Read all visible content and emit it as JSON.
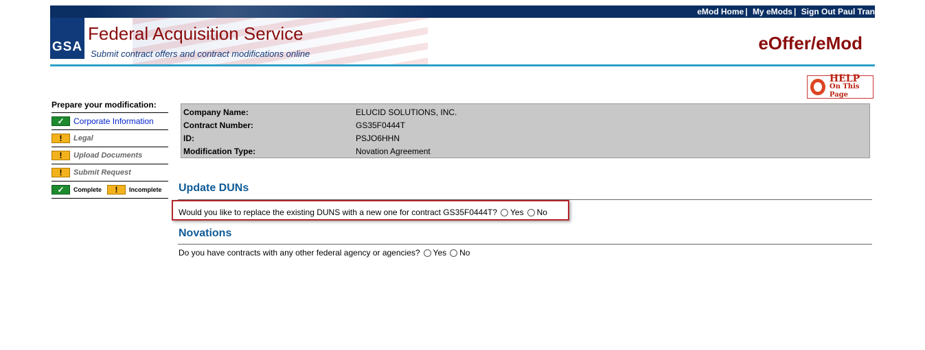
{
  "topnav": {
    "links": [
      "eMod Home",
      "My eMods",
      "Sign Out Paul Tran"
    ],
    "separator": "|"
  },
  "header": {
    "logo_text": "GSA",
    "title": "Federal Acquisition Service",
    "subtitle": "Submit contract offers and contract modifications online",
    "app_title": "eOffer/eMod"
  },
  "help": {
    "line1": "HELP",
    "line2": "On This Page"
  },
  "sidebar": {
    "heading": "Prepare your modification:",
    "items": [
      {
        "label": "Corporate Information",
        "status": "complete",
        "status_glyph": "✓"
      },
      {
        "label": "Legal",
        "status": "incomplete",
        "status_glyph": "!"
      },
      {
        "label": "Upload Documents",
        "status": "incomplete",
        "status_glyph": "!"
      },
      {
        "label": "Submit Request",
        "status": "incomplete",
        "status_glyph": "!"
      }
    ],
    "legend": {
      "complete": "Complete",
      "incomplete": "Incomplete"
    }
  },
  "info": {
    "rows": [
      {
        "key": "Company Name:",
        "value": "ELUCID SOLUTIONS, INC."
      },
      {
        "key": "Contract Number:",
        "value": "GS35F0444T"
      },
      {
        "key": "ID:",
        "value": "PSJO6HHN"
      },
      {
        "key": "Modification Type:",
        "value": "Novation Agreement"
      }
    ]
  },
  "duns": {
    "title": "Update DUNs",
    "question": "Would you like to replace the existing DUNS with a new one for contract GS35F0444T?",
    "yes": "Yes",
    "no": "No"
  },
  "novations": {
    "title": "Novations",
    "question": "Do you have contracts with any other federal agency or agencies?",
    "yes": "Yes",
    "no": "No"
  },
  "colors": {
    "header_red": "#8b0d0d",
    "nav_blue": "#0b2f63",
    "section_blue": "#0f5a96",
    "complete_green": "#1e8a2e",
    "incomplete_yellow": "#f3b21c",
    "highlight_red": "#b3262c"
  }
}
